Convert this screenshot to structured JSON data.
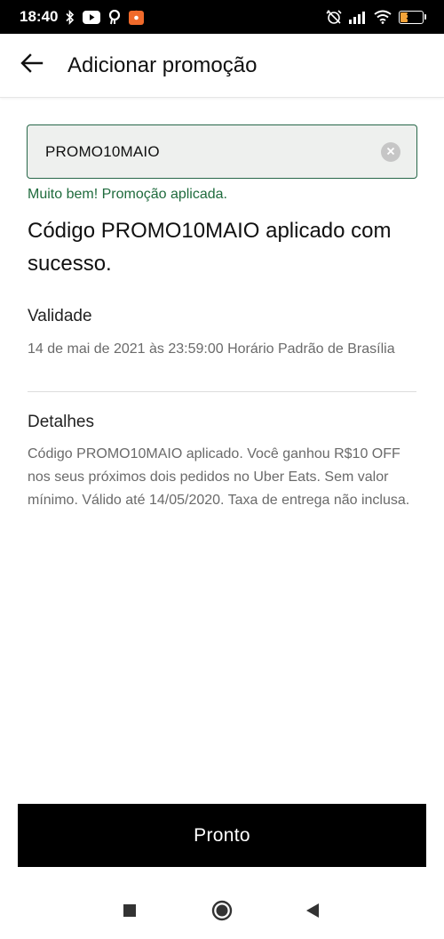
{
  "status_bar": {
    "time": "18:40",
    "battery": "39",
    "battery_fraction": 0.39,
    "icons": [
      "bluetooth-icon",
      "youtube-icon",
      "app-notification-icon",
      "shopee-icon",
      "alarm-off-icon",
      "signal-icon",
      "wifi-icon",
      "battery-icon"
    ]
  },
  "header": {
    "back_icon": "arrow-left-icon",
    "title": "Adicionar promoção"
  },
  "promo_input": {
    "value": "PROMO10MAIO",
    "clear_icon": "clear-circle-icon"
  },
  "success_message": "Muito bem! Promoção aplicada.",
  "headline": "Código PROMO10MAIO aplicado com sucesso.",
  "validity": {
    "title": "Validade",
    "text": "14 de mai de 2021 às 23:59:00 Horário Padrão de Brasília"
  },
  "details": {
    "title": "Detalhes",
    "text": "Código PROMO10MAIO aplicado. Você ganhou R$10 OFF nos seus próximos dois pedidos no Uber Eats. Sem valor mínimo. Válido até 14/05/2020. Taxa de entrega não inclusa."
  },
  "done_button": {
    "label": "Pronto"
  },
  "nav": {
    "recents_icon": "square-recents-icon",
    "home_icon": "circle-home-icon",
    "back_icon": "triangle-back-icon"
  },
  "colors": {
    "accent_green": "#276749",
    "success_text": "#1f6b3d",
    "button_bg": "#000000",
    "battery": "#f2a33a"
  }
}
